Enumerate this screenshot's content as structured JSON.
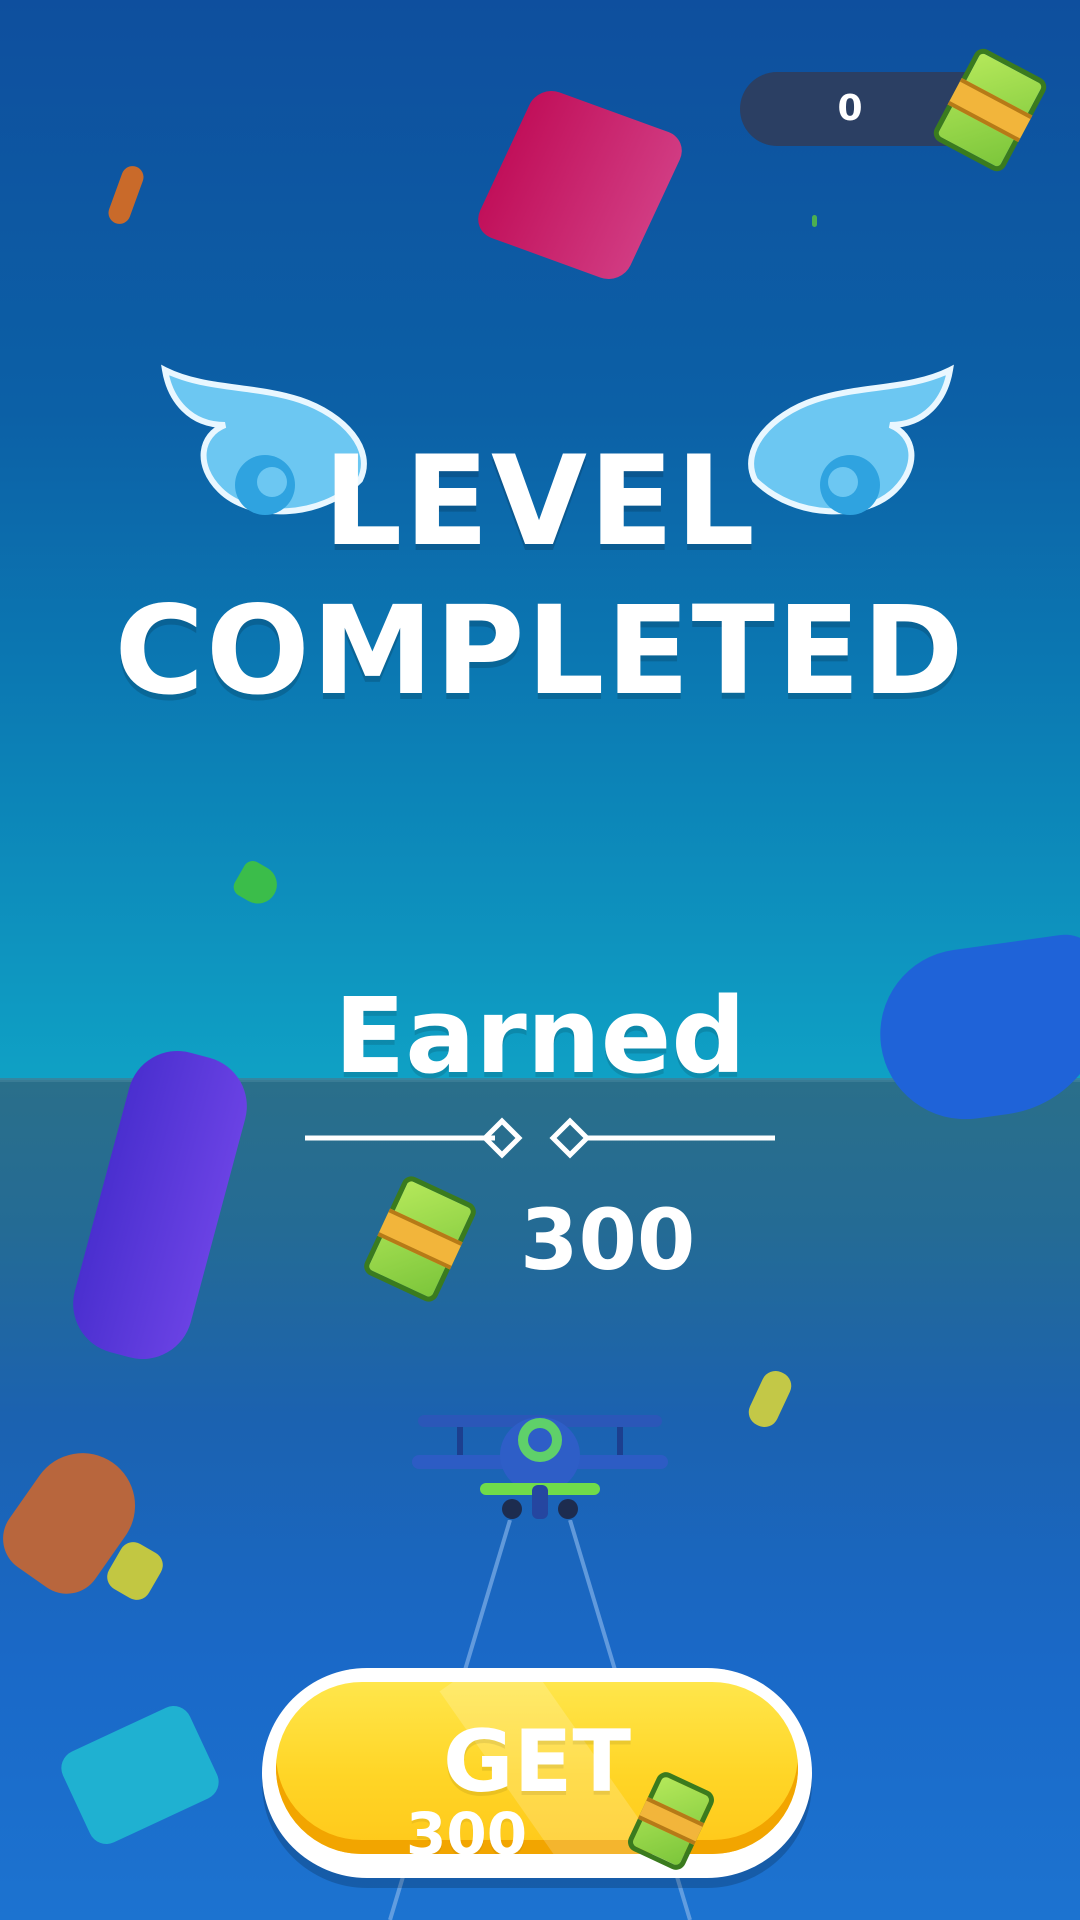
{
  "hud": {
    "currency_value": "0",
    "currency_icon": "cash-icon"
  },
  "title": {
    "line1": "LEVEL",
    "line2": "COMPLETED",
    "decoration_icon": "wing-icon"
  },
  "reward": {
    "label": "Earned",
    "value": "300",
    "icon": "cash-icon"
  },
  "get_button": {
    "label": "GET",
    "amount": "300",
    "icon": "cash-icon"
  },
  "colors": {
    "sky_top": "#0e4f9e",
    "sea": "#1b62b0",
    "button_yellow": "#ffd526",
    "pill_bg": "#2b3f63",
    "wing_blue": "#6cc7f2"
  }
}
